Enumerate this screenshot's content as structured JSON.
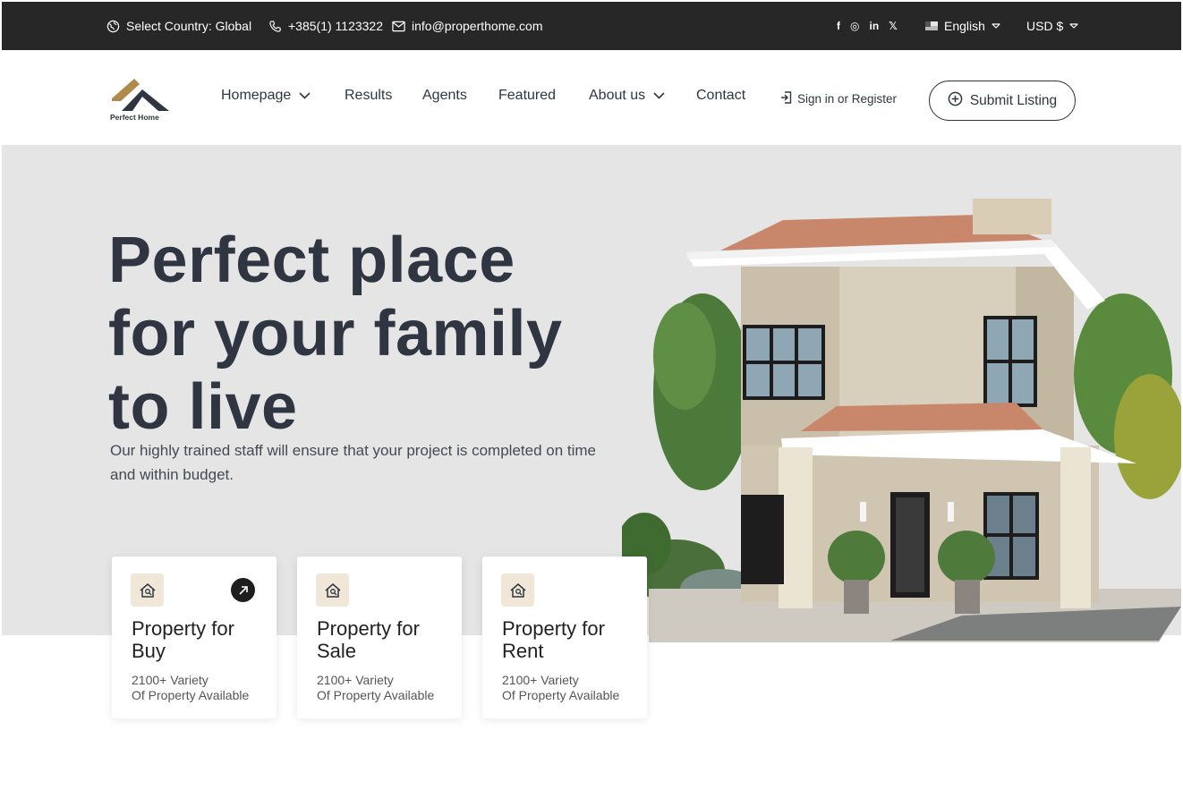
{
  "topbar": {
    "country": "Select Country: Global",
    "phone": "+385(1) 1123322",
    "email": "info@properthome.com",
    "social": {
      "facebook": "f",
      "instagram": "◎",
      "linkedin": "in",
      "x": "𝕏"
    },
    "language": "English",
    "currency": "USD $"
  },
  "brand": {
    "name": "Perfect Home"
  },
  "nav": {
    "items": [
      {
        "label": "Homepage"
      },
      {
        "label": "Results"
      },
      {
        "label": "Agents"
      },
      {
        "label": "Featured"
      },
      {
        "label": "About us"
      },
      {
        "label": "Contact"
      }
    ],
    "signin": "Sign in or Register",
    "submit": "Submit Listing"
  },
  "hero": {
    "title": "Perfect place for your family to live",
    "subtitle": "Our highly trained staff will ensure that your project is completed on time and within budget."
  },
  "cards": [
    {
      "title": "Property for Buy",
      "desc": "2100+ Variety\nOf  Property Available"
    },
    {
      "title": "Property for Sale",
      "desc": "2100+ Variety\nOf  Property Available"
    },
    {
      "title": "Property for Rent",
      "desc": "2100+ Variety\nOf  Property Available"
    }
  ],
  "colors": {
    "dark": "#272727",
    "text": "#2f3641",
    "hero_bg": "#e5e5e6",
    "accent": "#b08a4a",
    "card_icon_bg": "#f1e7d9"
  }
}
